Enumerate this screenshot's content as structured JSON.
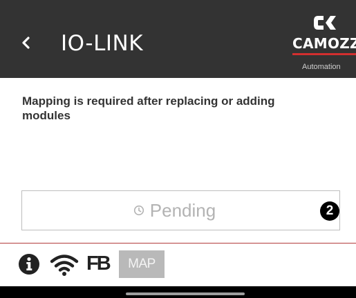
{
  "header": {
    "back_icon": "chevron-left-icon",
    "title": "IO-LINK",
    "logo": {
      "wordmark": "CAMOZZI",
      "tagline": "Automation",
      "accent_color": "#d32f2f"
    }
  },
  "main": {
    "message": "Mapping is required after replacing or adding modules",
    "status": {
      "icon": "clock-icon",
      "text": "Pending",
      "badge": "2"
    }
  },
  "bottom_bar": {
    "info_icon": "info-icon",
    "wifi_icon": "wifi-icon",
    "fb_label": "FB",
    "map_label": "MAP"
  },
  "colors": {
    "header_bg": "#333333",
    "divider": "#b33b3b",
    "map_bg": "#b9b9b9"
  }
}
